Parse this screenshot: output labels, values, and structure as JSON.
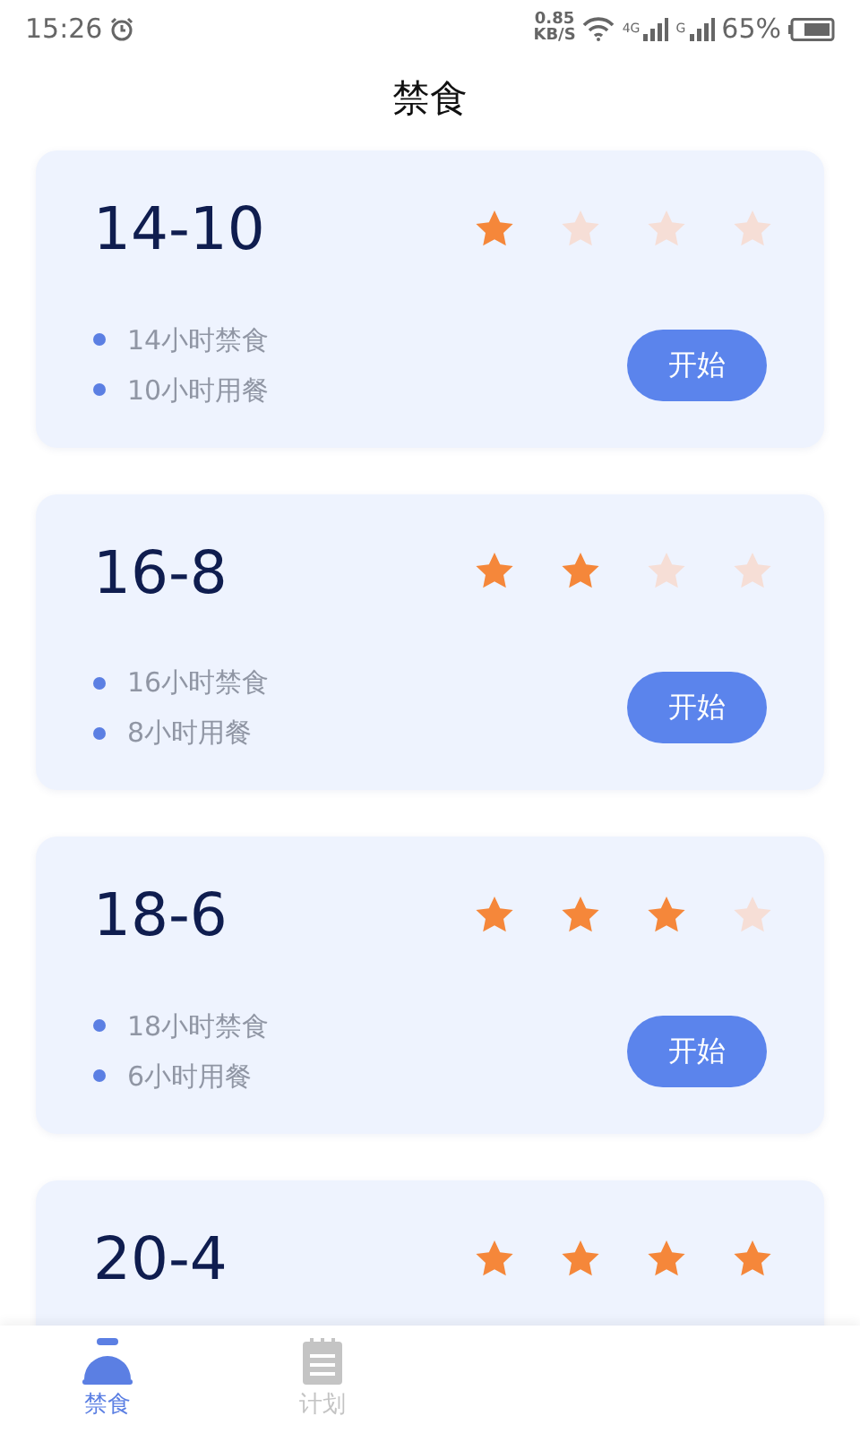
{
  "status_bar": {
    "time": "15:26",
    "speed_value": "0.85",
    "speed_unit": "KB/S",
    "network_1": "4G",
    "network_2": "G",
    "battery": "65%"
  },
  "title": "禁食",
  "plans": [
    {
      "name": "14-10",
      "stars": 1,
      "lines": [
        "14小时禁食",
        "10小时用餐"
      ],
      "button": "开始"
    },
    {
      "name": "16-8",
      "stars": 2,
      "lines": [
        "16小时禁食",
        "8小时用餐"
      ],
      "button": "开始"
    },
    {
      "name": "18-6",
      "stars": 3,
      "lines": [
        "18小时禁食",
        "6小时用餐"
      ],
      "button": "开始"
    },
    {
      "name": "20-4",
      "stars": 4
    }
  ],
  "bottom_nav": [
    {
      "label": "禁食",
      "kind": "bowl",
      "selected": true
    },
    {
      "label": "计划",
      "kind": "notepad",
      "selected": false
    }
  ]
}
